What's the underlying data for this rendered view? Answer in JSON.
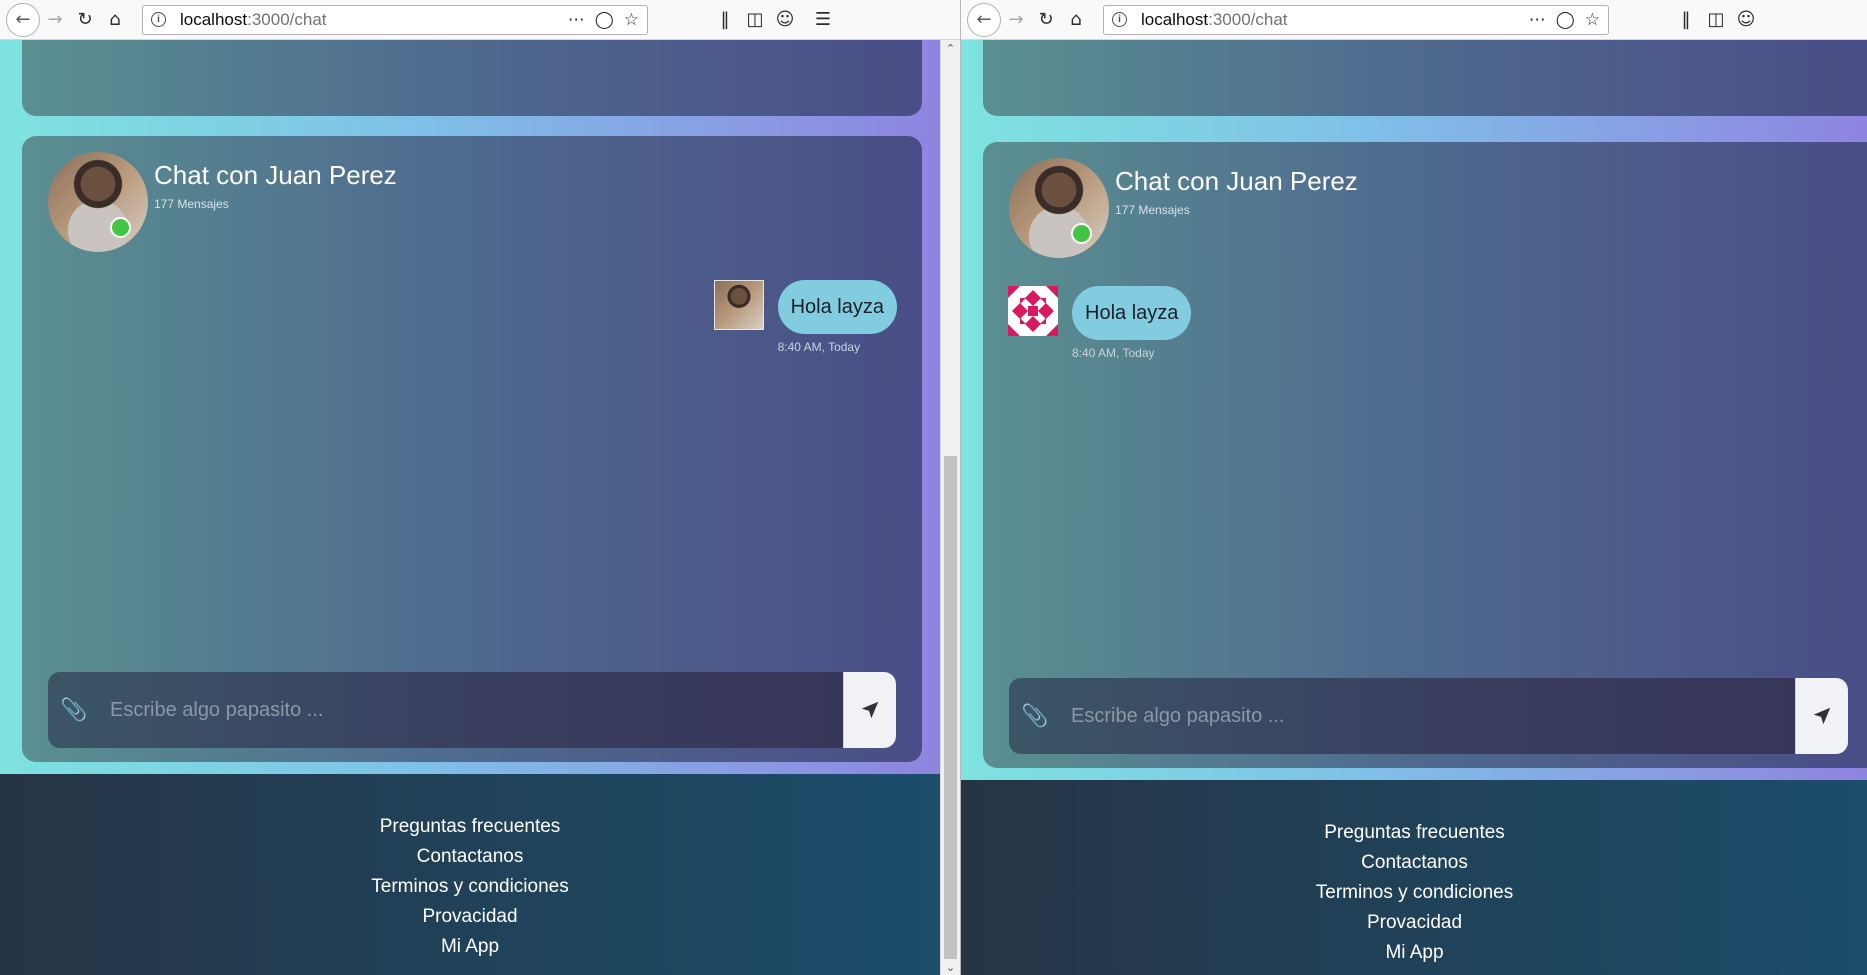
{
  "windows": [
    {
      "url_host": "localhost",
      "url_path": ":3000/chat",
      "chat": {
        "title": "Chat con Juan Perez",
        "subtitle": "177 Mensajes",
        "message": {
          "text": "Hola layza",
          "time": "8:40 AM, Today",
          "avatar": "photo"
        },
        "input_placeholder": "Escribe algo papasito ..."
      }
    },
    {
      "url_host": "localhost",
      "url_path": ":3000/chat",
      "chat": {
        "title": "Chat con Juan Perez",
        "subtitle": "177 Mensajes",
        "message": {
          "text": "Hola layza",
          "time": "8:40 AM, Today",
          "avatar": "identicon"
        },
        "input_placeholder": "Escribe algo papasito ..."
      }
    }
  ],
  "footer": {
    "links": [
      "Preguntas frecuentes",
      "Contactanos",
      "Terminos y condiciones",
      "Provacidad",
      "Mi App"
    ]
  },
  "icons": {
    "back": "back-arrow-icon",
    "forward": "forward-arrow-icon",
    "reload": "reload-icon",
    "home": "home-icon",
    "info": "info-icon",
    "more": "more-icon",
    "pocket": "pocket-icon",
    "bookmark": "star-icon",
    "library": "library-icon",
    "sidebar": "sidebar-icon",
    "account": "account-icon",
    "menu": "hamburger-menu-icon",
    "attach": "paperclip-icon",
    "send": "send-icon"
  },
  "colors": {
    "online": "#42c542",
    "bubble": "#82cce0",
    "identicon": "#d81b60"
  }
}
